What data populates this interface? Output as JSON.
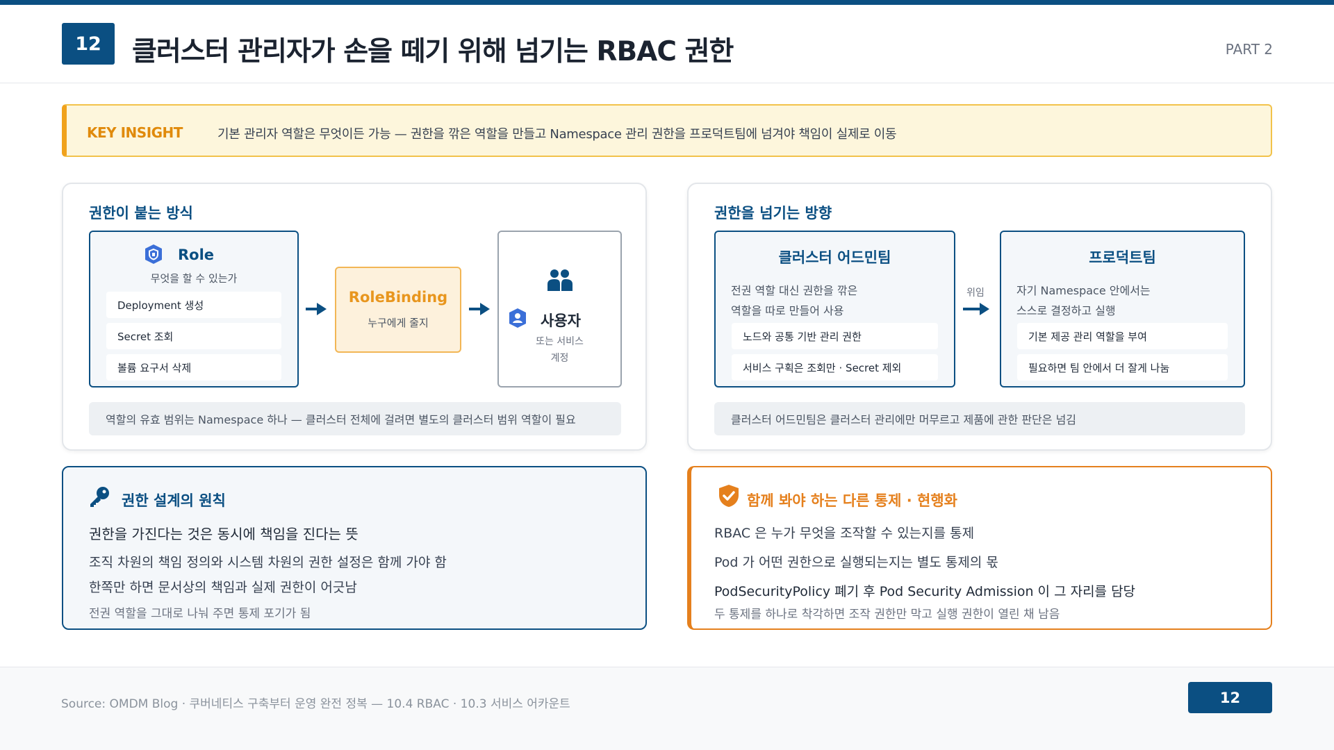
{
  "header": {
    "page_number": "12",
    "title": "클러스터 관리자가 손을 떼기 위해 넘기는 RBAC 권한",
    "part": "PART 2"
  },
  "insight": {
    "tag": "KEY INSIGHT",
    "text": "기본 관리자 역할은 무엇이든 가능 — 권한을 깎은 역할을 만들고 Namespace 관리 권한을 프로덕트팀에 넘겨야 책임이 실제로 이동"
  },
  "left_panel": {
    "title": "권한이 붙는 방식",
    "role": {
      "icon": "shield-badge-icon",
      "title": "Role",
      "subtitle": "무엇을 할 수 있는가",
      "items": [
        "Deployment 생성",
        "Secret 조회",
        "볼륨 요구서 삭제"
      ]
    },
    "rolebinding": {
      "title": "RoleBinding",
      "subtitle": "누구에게 줄지"
    },
    "user": {
      "title": "사용자",
      "subtitle_line1": "또는 서비스",
      "subtitle_line2": "계정"
    },
    "note": "역할의 유효 범위는 Namespace 하나 — 클러스터 전체에 걸려면 별도의 클러스터 범위 역할이 필요"
  },
  "right_panel": {
    "title": "권한을 넘기는 방향",
    "admin": {
      "title": "클러스터 어드민팀",
      "desc_line1": "전권 역할 대신 권한을 깎은",
      "desc_line2": "역할을 따로 만들어 사용",
      "items": [
        "노드와 공통 기반 관리 권한",
        "서비스 구획은 조회만 · Secret 제외"
      ]
    },
    "delegate_label": "위임",
    "product": {
      "title": "프로덕트팀",
      "desc_line1": "자기 Namespace 안에서는",
      "desc_line2": "스스로 결정하고 실행",
      "items": [
        "기본 제공 관리 역할을 부여",
        "필요하면 팀 안에서 더 잘게 나눔"
      ]
    },
    "note": "클러스터 어드민팀은 클러스터 관리에만 머무르고 제품에 관한 판단은 넘김"
  },
  "principles": {
    "title": "권한 설계의 원칙",
    "lead": "권한을 가진다는 것은 동시에 책임을 진다는 뜻",
    "line1": "조직 차원의 책임 정의와 시스템 차원의 권한 설정은 함께 가야 함",
    "line2": "한쪽만 하면 문서상의 책임과 실제 권한이 어긋남",
    "line3": "전권 역할을 그대로 나눠 주면 통제 포기가 됨"
  },
  "controls": {
    "title": "함께 봐야 하는 다른 통제 · 현행화",
    "line1": "RBAC 은 누가 무엇을 조작할 수 있는지를 통제",
    "line2": "Pod 가 어떤 권한으로 실행되는지는 별도 통제의 몫",
    "line3": "PodSecurityPolicy 폐기 후 Pod Security Admission 이 그 자리를 담당",
    "line4": "두 통제를 하나로 착각하면 조작 권한만 막고 실행 권한이 열린 채 남음"
  },
  "footer": {
    "source": "Source: OMDM Blog · 쿠버네티스 구축부터 운영 완전 정복 — 10.4 RBAC · 10.3 서비스 어카운트",
    "page_number": "12"
  },
  "colors": {
    "primary": "#0b4f82",
    "accent_orange": "#e5801d",
    "insight_bg": "#fdf6dc",
    "rolebinding_orange": "#e8961e"
  }
}
